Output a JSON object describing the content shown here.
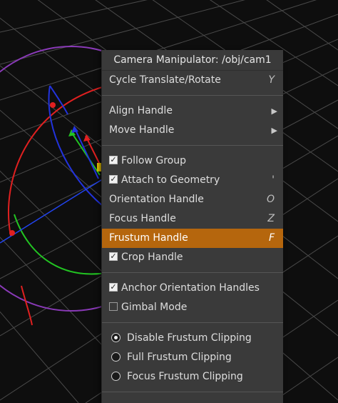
{
  "menu": {
    "title": "Camera Manipulator: /obj/cam1",
    "groups": [
      [
        {
          "label": "Cycle Translate/Rotate",
          "shortcut": "Y"
        }
      ],
      [
        {
          "label": "Align Handle",
          "submenu": "▶"
        },
        {
          "label": "Move Handle",
          "submenu": "▶"
        }
      ],
      [
        {
          "label": "Follow Group",
          "checked": true
        },
        {
          "label": "Attach to Geometry",
          "checked": true,
          "shortcut": "'"
        },
        {
          "label": "Orientation Handle",
          "shortcut": "O"
        },
        {
          "label": "Focus Handle",
          "shortcut": "Z"
        },
        {
          "label": "Frustum Handle",
          "shortcut": "F",
          "highlighted": true
        },
        {
          "label": "Crop Handle",
          "checked": true
        }
      ],
      [
        {
          "label": "Anchor Orientation Handles",
          "checked": true
        },
        {
          "label": "Gimbal Mode",
          "checked": false
        }
      ],
      [
        {
          "label": "Disable Frustum Clipping",
          "radio": true,
          "selected": true
        },
        {
          "label": "Full Frustum Clipping",
          "radio": true,
          "selected": false
        },
        {
          "label": "Focus Frustum Clipping",
          "radio": true,
          "selected": false
        }
      ]
    ]
  },
  "colors": {
    "menu_bg": "#3a3a3a",
    "highlight": "#b5660d",
    "grid": "#4a4a4a",
    "x_axis": "#e02020",
    "y_axis": "#22c422",
    "z_axis": "#2233dd",
    "circle_purple": "#8a3ab8"
  }
}
